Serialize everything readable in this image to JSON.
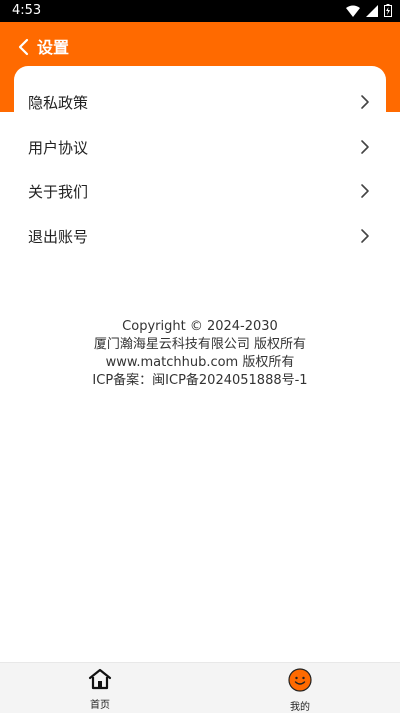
{
  "status_bar": {
    "time": "4:53"
  },
  "header": {
    "title": "设置"
  },
  "menu": [
    {
      "label": "隐私政策"
    },
    {
      "label": "用户协议"
    },
    {
      "label": "关于我们"
    },
    {
      "label": "退出账号"
    }
  ],
  "copyright": {
    "line1": "Copyright © 2024-2030",
    "line2": "厦门瀚海星云科技有限公司 版权所有",
    "line3": "www.matchhub.com 版权所有",
    "line4": "ICP备案：闽ICP备2024051888号-1"
  },
  "tabbar": {
    "tabs": [
      {
        "label": "首页",
        "icon": "home-icon"
      },
      {
        "label": "我的",
        "icon": "profile-face-icon"
      }
    ]
  },
  "colors": {
    "accent": "#ff6a00"
  }
}
